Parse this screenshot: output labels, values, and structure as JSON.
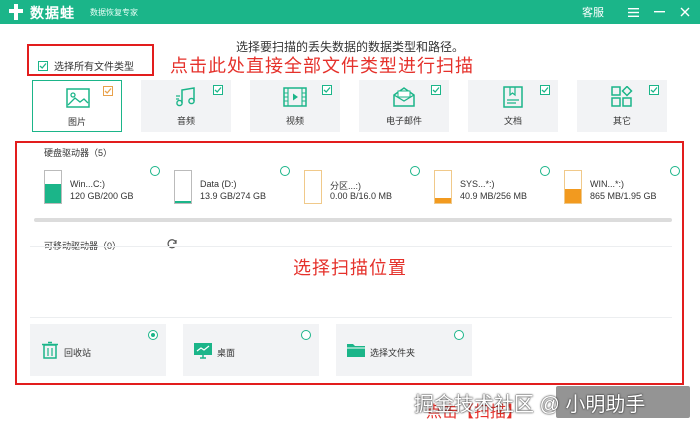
{
  "app": {
    "name": "数据蛙",
    "slogan": "数据恢复专家",
    "support_label": "客服"
  },
  "colors": {
    "brand": "#1bb589",
    "annotation": "#e5312b",
    "annotation_box": "#e21d1d",
    "drive_fill_green": "#1bb589",
    "drive_fill_orange": "#f29a1f"
  },
  "filetypes": {
    "select_all_label": "选择所有文件类型",
    "instruction": "选择要扫描的丢失数据的数据类型和路径。",
    "items": [
      {
        "label": "图片",
        "icon": "image-icon",
        "checked": true
      },
      {
        "label": "音频",
        "icon": "music-icon",
        "checked": true
      },
      {
        "label": "视频",
        "icon": "video-icon",
        "checked": true
      },
      {
        "label": "电子邮件",
        "icon": "email-icon",
        "checked": true
      },
      {
        "label": "文档",
        "icon": "document-icon",
        "checked": true
      },
      {
        "label": "其它",
        "icon": "other-icon",
        "checked": true
      }
    ]
  },
  "drives": {
    "title": "硬盘驱动器（5）",
    "items": [
      {
        "name": "Win...C:)",
        "size": "120 GB/200 GB",
        "used_fraction": 0.6,
        "fill_color": "#1bb589",
        "icon": "disk-windows-icon"
      },
      {
        "name": "Data (D:)",
        "size": "13.9 GB/274 GB",
        "used_fraction": 0.05,
        "fill_color": "#1bb589",
        "icon": "disk-icon"
      },
      {
        "name": "分区...:)",
        "size": "0.00  B/16.0 MB",
        "used_fraction": 0.0,
        "fill_color": "#f29a1f",
        "icon": "disk-icon"
      },
      {
        "name": "SYS...*:)",
        "size": "40.9 MB/256 MB",
        "used_fraction": 0.16,
        "fill_color": "#f29a1f",
        "icon": "disk-windows-icon"
      },
      {
        "name": "WIN...*:)",
        "size": "865 MB/1.95 GB",
        "used_fraction": 0.44,
        "fill_color": "#f29a1f",
        "icon": "disk-windows-icon"
      }
    ]
  },
  "removable": {
    "title": "可移动驱动器（0）"
  },
  "locations": [
    {
      "label": "回收站",
      "icon": "recycle-bin-icon",
      "selected": true
    },
    {
      "label": "桌面",
      "icon": "desktop-icon",
      "selected": false
    },
    {
      "label": "选择文件夹",
      "icon": "folder-icon",
      "selected": false
    }
  ],
  "annotations": {
    "top": "点击此处直接全部文件类型进行扫描",
    "middle": "选择扫描位置",
    "bottom": "点击【扫描】"
  },
  "watermark": "掘金技术社区 @ 小明助手"
}
